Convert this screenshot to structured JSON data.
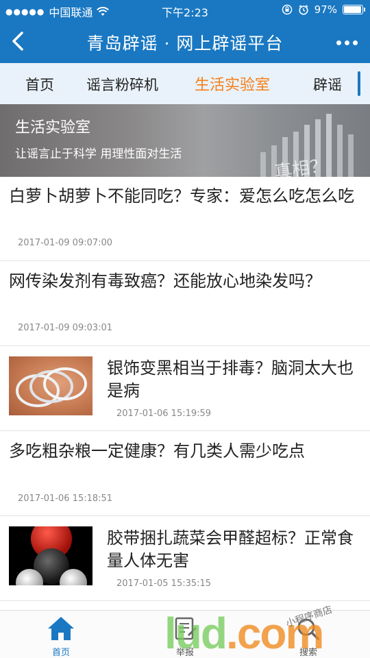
{
  "status": {
    "carrier": "中国联通",
    "time": "下午2:23",
    "battery_text": "97%",
    "battery_level": 0.97
  },
  "navbar": {
    "title": "青岛辟谣 · 网上辟谣平台"
  },
  "tabs": [
    "首页",
    "谣言粉碎机",
    "生活实验室",
    "辟谣"
  ],
  "active_tab": "生活实验室",
  "banner": {
    "title": "生活实验室",
    "subtitle": "让谣言止于科学 用理性面对生活",
    "art_text": "真相？"
  },
  "articles": [
    {
      "title": "白萝卜胡萝卜不能同吃？专家：爱怎么吃怎么吃",
      "date": "2017-01-09 09:07:00",
      "has_thumb": false
    },
    {
      "title": "网传染发剂有毒致癌？还能放心地染发吗？",
      "date": "2017-01-09 09:03:01",
      "has_thumb": false
    },
    {
      "title": "银饰变黑相当于排毒？脑洞太大也是病",
      "date": "2017-01-06 15:19:59",
      "has_thumb": true,
      "thumb": "silver-bracelets"
    },
    {
      "title": "多吃粗杂粮一定健康？有几类人需少吃点",
      "date": "2017-01-06 15:18:51",
      "has_thumb": false
    },
    {
      "title": "胶带捆扎蔬菜会甲醛超标？正常食量人体无害",
      "date": "2017-01-05 15:35:15",
      "has_thumb": true,
      "thumb": "molecule-model"
    }
  ],
  "tabbar": {
    "items": [
      {
        "label": "首页",
        "icon": "home-icon",
        "active": true
      },
      {
        "label": "举报",
        "icon": "report-icon",
        "active": false
      },
      {
        "label": "搜索",
        "icon": "search-icon",
        "active": false
      }
    ]
  },
  "watermark": {
    "text_main": "lud",
    "text_dot": ".com",
    "hand_text": "小程序商店"
  },
  "colors": {
    "primary": "#1a78c2",
    "active_tab": "#f57e18",
    "tab_bg": "#e9f2fa"
  }
}
